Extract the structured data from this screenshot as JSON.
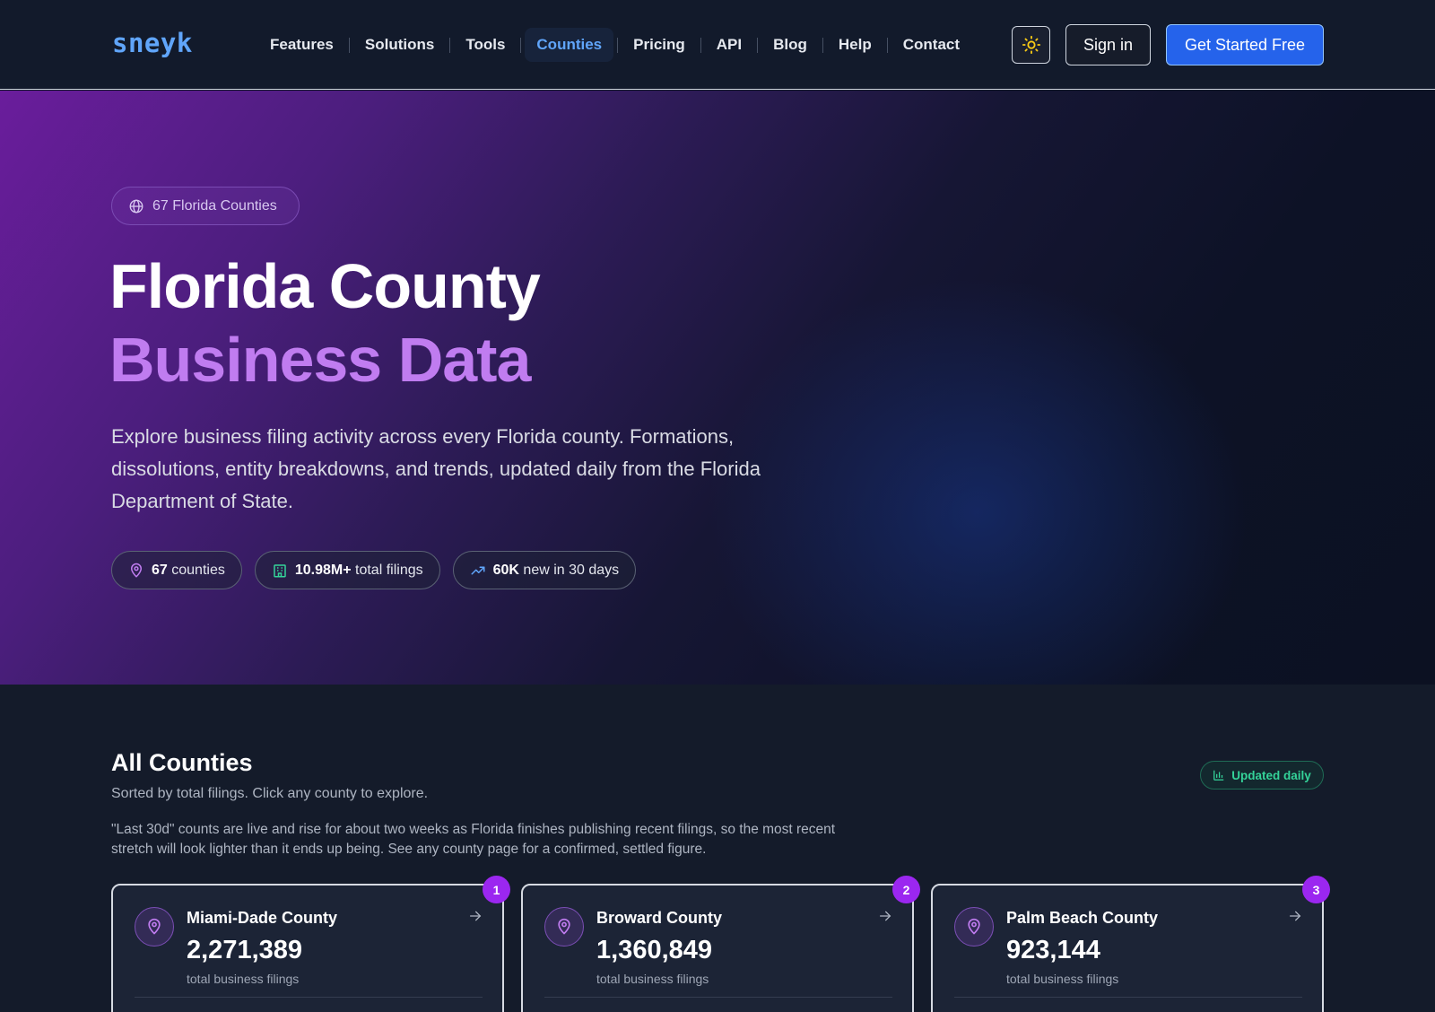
{
  "nav": {
    "logo": "sneyk",
    "links": [
      "Features",
      "Solutions",
      "Tools",
      "Counties",
      "Pricing",
      "API",
      "Blog",
      "Help",
      "Contact"
    ],
    "active": "Counties",
    "sign_in": "Sign in",
    "cta": "Get Started Free"
  },
  "hero": {
    "badge": "67 Florida Counties",
    "title_line1": "Florida County",
    "title_line2": "Business Data",
    "description": "Explore business filing activity across every Florida county. Formations, dissolutions, entity breakdowns, and trends, updated daily from the Florida Department of State.",
    "stats": [
      {
        "icon": "map-pin-icon",
        "value": "67",
        "label": "counties"
      },
      {
        "icon": "building-icon",
        "value": "10.98M+",
        "label": "total filings"
      },
      {
        "icon": "trending-up-icon",
        "value": "60K",
        "label": "new in 30 days"
      }
    ]
  },
  "counties": {
    "title": "All Counties",
    "subtitle": "Sorted by total filings. Click any county to explore.",
    "note": "\"Last 30d\" counts are live and rise for about two weeks as Florida finishes publishing recent filings, so the most recent stretch will look lighter than it ends up being. See any county page for a confirmed, settled figure.",
    "badge": "Updated daily",
    "cards": [
      {
        "rank": "1",
        "name": "Miami-Dade County",
        "count": "2,271,389",
        "label": "total business filings"
      },
      {
        "rank": "2",
        "name": "Broward County",
        "count": "1,360,849",
        "label": "total business filings"
      },
      {
        "rank": "3",
        "name": "Palm Beach County",
        "count": "923,144",
        "label": "total business filings"
      }
    ]
  },
  "colors": {
    "accent_blue": "#2563eb",
    "accent_purple": "#c07cf0",
    "rank_purple": "#9b27f0",
    "updated_green": "#34d399"
  }
}
